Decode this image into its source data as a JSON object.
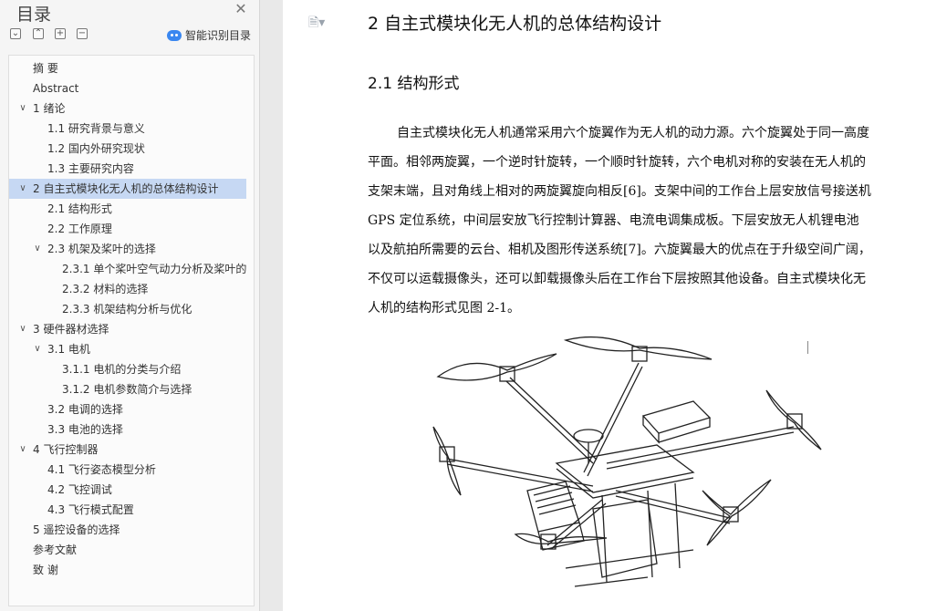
{
  "sidebar": {
    "title": "目录",
    "smart_label": "智能识别目录",
    "toc": [
      {
        "label": "摘  要",
        "level": 1,
        "caret": "",
        "selected": false
      },
      {
        "label": "Abstract",
        "level": 1,
        "caret": "",
        "selected": false
      },
      {
        "label": "1  绪论",
        "level": 1,
        "caret": "∨",
        "selected": false
      },
      {
        "label": "1.1  研究背景与意义",
        "level": 2,
        "caret": "",
        "selected": false
      },
      {
        "label": "1.2  国内外研究现状",
        "level": 2,
        "caret": "",
        "selected": false
      },
      {
        "label": "1.3  主要研究内容",
        "level": 2,
        "caret": "",
        "selected": false
      },
      {
        "label": "2 自主式模块化无人机的总体结构设计",
        "level": 1,
        "caret": "∨",
        "selected": true
      },
      {
        "label": "2.1 结构形式",
        "level": 2,
        "caret": "",
        "selected": false
      },
      {
        "label": "2.2 工作原理",
        "level": 2,
        "caret": "",
        "selected": false
      },
      {
        "label": "2.3 机架及桨叶的选择",
        "level": 2,
        "caret": "∨",
        "selected": false
      },
      {
        "label": "2.3.1 单个桨叶空气动力分析及桨叶的选择",
        "level": 3,
        "caret": "",
        "selected": false
      },
      {
        "label": "2.3.2 材料的选择",
        "level": 3,
        "caret": "",
        "selected": false
      },
      {
        "label": "2.3.3 机架结构分析与优化",
        "level": 3,
        "caret": "",
        "selected": false
      },
      {
        "label": "3 硬件器材选择",
        "level": 1,
        "caret": "∨",
        "selected": false
      },
      {
        "label": "3.1 电机",
        "level": 2,
        "caret": "∨",
        "selected": false
      },
      {
        "label": "3.1.1 电机的分类与介绍",
        "level": 3,
        "caret": "",
        "selected": false
      },
      {
        "label": "3.1.2 电机参数简介与选择",
        "level": 3,
        "caret": "",
        "selected": false
      },
      {
        "label": "3.2 电调的选择",
        "level": 2,
        "caret": "",
        "selected": false
      },
      {
        "label": "3.3 电池的选择",
        "level": 2,
        "caret": "",
        "selected": false
      },
      {
        "label": "4 飞行控制器",
        "level": 1,
        "caret": "∨",
        "selected": false
      },
      {
        "label": "4.1 飞行姿态模型分析",
        "level": 2,
        "caret": "",
        "selected": false
      },
      {
        "label": "4.2 飞控调试",
        "level": 2,
        "caret": "",
        "selected": false
      },
      {
        "label": "4.3 飞行模式配置",
        "level": 2,
        "caret": "",
        "selected": false
      },
      {
        "label": "5 遥控设备的选择",
        "level": 1,
        "caret": "",
        "selected": false
      },
      {
        "label": "参考文献",
        "level": 1,
        "caret": "",
        "selected": false
      },
      {
        "label": "致    谢",
        "level": 1,
        "caret": "",
        "selected": false
      }
    ]
  },
  "document": {
    "heading1": "2 自主式模块化无人机的总体结构设计",
    "heading2": "2.1 结构形式",
    "paragraph_lines": [
      "自主式模块化无人机通常采用六个旋翼作为无人机的动力源。六个旋翼处于同一高度",
      "平面。相邻两旋翼，一个逆时针旋转，一个顺时针旋转，六个电机对称的安装在无人机的",
      "支架末端，且对角线上相对的两旋翼旋向相反[6]。支架中间的工作台上层安放信号接送机",
      "GPS 定位系统，中间层安放飞行控制计算器、电流电调集成板。下层安放无人机锂电池",
      "以及航拍所需要的云台、相机及图形传送系统[7]。六旋翼最大的优点在于升级空间广阔，",
      "不仅可以运载摄像头，还可以卸载摄像头后在工作台下层按照其他设备。自主式模块化无",
      "人机的结构形式见图 2-1。"
    ]
  }
}
